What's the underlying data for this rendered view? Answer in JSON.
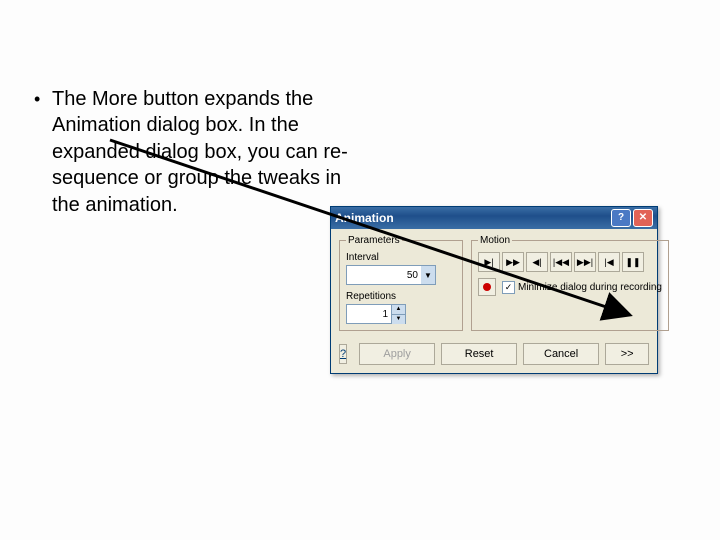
{
  "bullet": {
    "text": "The More button expands the Animation dialog box. In the expanded dialog box, you can re-sequence or group the tweaks in the animation."
  },
  "dialog": {
    "title": "Animation",
    "params": {
      "legend": "Parameters",
      "interval_label": "Interval",
      "interval_value": "50",
      "repetitions_label": "Repetitions",
      "repetitions_value": "1"
    },
    "motion": {
      "legend": "Motion",
      "checkbox_label": "Minimize dialog during recording",
      "checkbox_checked": "✓"
    },
    "buttons": {
      "help": "?",
      "apply": "Apply",
      "reset": "Reset",
      "cancel": "Cancel",
      "more": ">>"
    },
    "title_close": "✕",
    "title_help": "?"
  }
}
